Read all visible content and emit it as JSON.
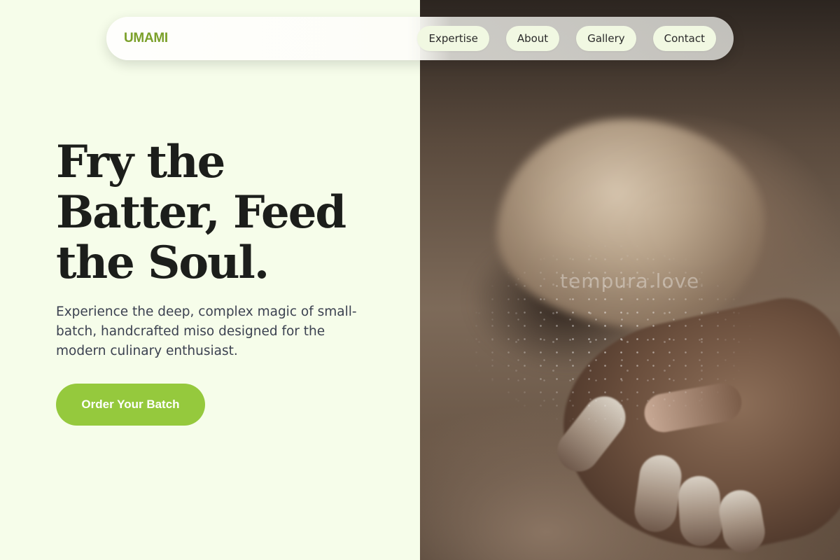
{
  "nav": {
    "brand": "UMAMI",
    "links": [
      "Expertise",
      "About",
      "Gallery",
      "Contact"
    ]
  },
  "hero": {
    "title": "Fry the Batter, Feed the Soul.",
    "subtitle": "Experience the deep, complex magic of small-batch, handcrafted miso designed for the modern culinary enthusiast.",
    "cta_label": "Order Your Batch",
    "image_watermark": "tempura.love"
  },
  "colors": {
    "background": "#f6fdea",
    "brand_green": "#7ba02a",
    "cta_green": "#95c93d",
    "nav_pill": "#f1f8e2",
    "heading": "#1c1e1b",
    "body_text": "#3b4150"
  }
}
